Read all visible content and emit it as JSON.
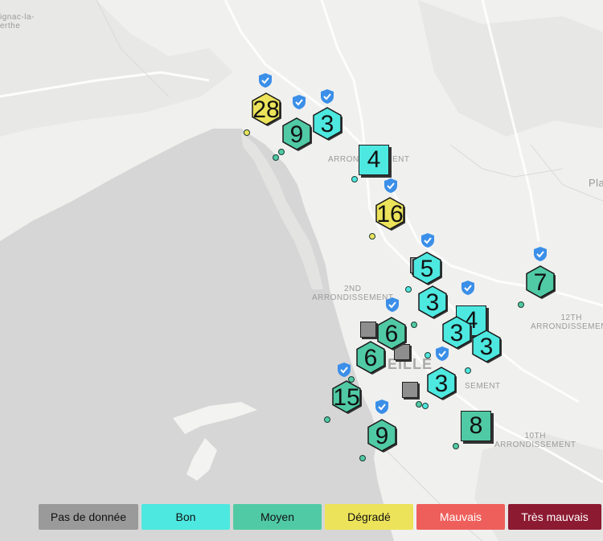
{
  "place_labels": [
    {
      "name": "ignac-la-",
      "name2": "erthe"
    },
    {
      "name": "ARRONDISSEMENT"
    },
    {
      "name": "2ND",
      "name2": "ARRONDISSEMENT"
    },
    {
      "name": "12TH",
      "name2": "ARRONDISSEMENT"
    },
    {
      "name": "10TH",
      "name2": "ARRONDISSEMENT"
    },
    {
      "name": "SEMENT"
    },
    {
      "name": "EILLE"
    },
    {
      "name": "Pla"
    }
  ],
  "colors": {
    "bon": "#4de8e0",
    "moyen": "#50caa4",
    "degrade": "#ece35a",
    "mauvais": "#ee5f5b",
    "tres_mauvais": "#8c1a31",
    "no_data": "#8e8e8e"
  },
  "markers": [
    {
      "value": "28",
      "level": "degrade",
      "shape": "hex"
    },
    {
      "value": "9",
      "level": "moyen",
      "shape": "hex"
    },
    {
      "value": "3",
      "level": "bon",
      "shape": "hex"
    },
    {
      "value": "4",
      "level": "bon",
      "shape": "square"
    },
    {
      "value": "16",
      "level": "degrade",
      "shape": "hex"
    },
    {
      "value": "5",
      "level": "bon",
      "shape": "hex"
    },
    {
      "value": "7",
      "level": "moyen",
      "shape": "hex"
    },
    {
      "value": "3",
      "level": "bon",
      "shape": "hex"
    },
    {
      "value": "4",
      "level": "bon",
      "shape": "square"
    },
    {
      "value": "3",
      "level": "bon",
      "shape": "hex"
    },
    {
      "value": "3",
      "level": "bon",
      "shape": "hex"
    },
    {
      "value": "6",
      "level": "moyen",
      "shape": "hex"
    },
    {
      "value": "6",
      "level": "moyen",
      "shape": "hex"
    },
    {
      "value": "3",
      "level": "bon",
      "shape": "hex"
    },
    {
      "value": "15",
      "level": "moyen",
      "shape": "hex"
    },
    {
      "value": "8",
      "level": "moyen",
      "shape": "square"
    },
    {
      "value": "9",
      "level": "moyen",
      "shape": "hex"
    }
  ],
  "legend": [
    {
      "label": "Pas de donnée",
      "color": "#9a9a9a"
    },
    {
      "label": "Bon",
      "color": "#4de8e0"
    },
    {
      "label": "Moyen",
      "color": "#50caa4"
    },
    {
      "label": "Dégradé",
      "color": "#ece35a"
    },
    {
      "label": "Mauvais",
      "color": "#ee5f5b",
      "text_color": "#ffffff"
    },
    {
      "label": "Très mauvais",
      "color": "#8c1a31",
      "text_color": "#ffffff"
    }
  ]
}
